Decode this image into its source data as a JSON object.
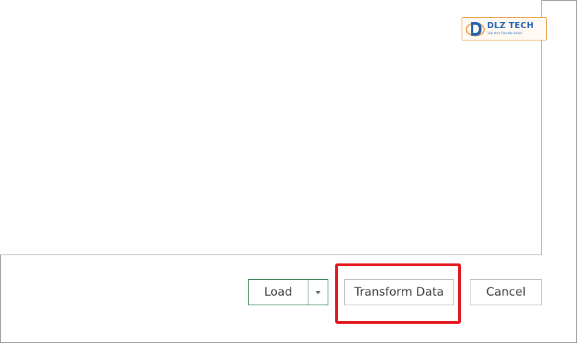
{
  "watermark": {
    "brand": "DLZ TECH",
    "tagline": "Tinh tế từ Tâm đến Khách"
  },
  "footer": {
    "load_label": "Load",
    "transform_label": "Transform Data",
    "cancel_label": "Cancel"
  },
  "colors": {
    "load_border": "#2f7d4a",
    "highlight": "#e2161d",
    "watermark_accent": "#e8a24a",
    "watermark_text": "#1f5fb4"
  },
  "icons": {
    "load_dropdown": "caret-down-icon",
    "watermark_logo": "dlz-logo-icon"
  }
}
